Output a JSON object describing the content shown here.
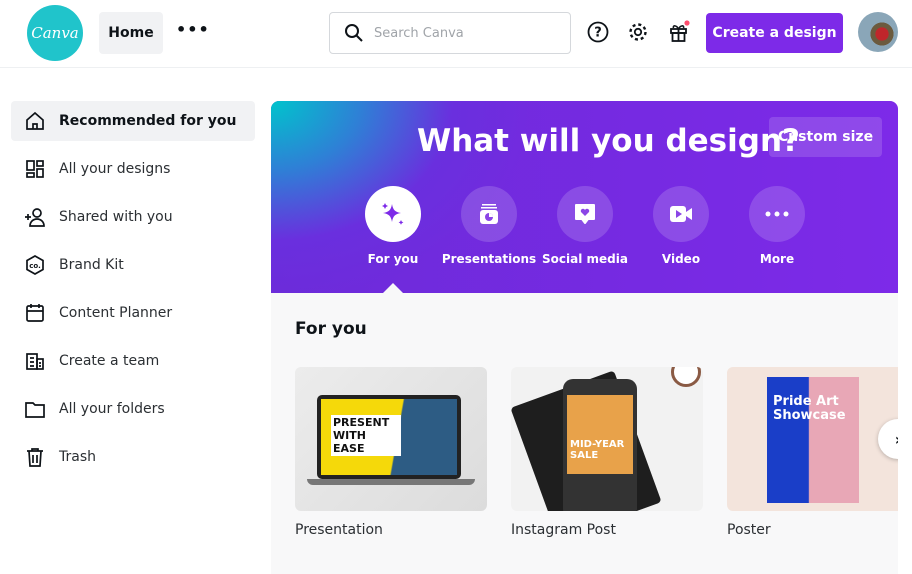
{
  "header": {
    "logo": "Canva",
    "home": "Home",
    "more": "•••",
    "search_placeholder": "Search Canva",
    "create": "Create a design",
    "notification_color": "#ff4d6d"
  },
  "sidebar": {
    "items": [
      {
        "label": "Recommended for you",
        "icon": "home-icon",
        "selected": true
      },
      {
        "label": "All your designs",
        "icon": "grid-icon"
      },
      {
        "label": "Shared with you",
        "icon": "users-icon"
      },
      {
        "label": "Brand Kit",
        "icon": "brand-kit-icon"
      },
      {
        "label": "Content Planner",
        "icon": "calendar-icon"
      },
      {
        "label": "Create a team",
        "icon": "building-icon"
      },
      {
        "label": "All your folders",
        "icon": "folder-icon"
      },
      {
        "label": "Trash",
        "icon": "trash-icon"
      }
    ]
  },
  "banner": {
    "title": "What will you design?",
    "custom_size": "Custom size",
    "categories": [
      {
        "label": "For you",
        "icon": "sparkle-icon"
      },
      {
        "label": "Presentations",
        "icon": "presentation-icon"
      },
      {
        "label": "Social media",
        "icon": "heart-bubble-icon"
      },
      {
        "label": "Video",
        "icon": "video-icon"
      },
      {
        "label": "More",
        "icon": "more-icon"
      }
    ]
  },
  "for_you": {
    "title": "For you",
    "cards": [
      {
        "label": "Presentation",
        "thumb_text": "PRESENT WITH EASE"
      },
      {
        "label": "Instagram Post",
        "thumb_text": "MID-YEAR SALE"
      },
      {
        "label": "Poster",
        "thumb_text": "Pride Art Showcase"
      }
    ]
  },
  "accent": "#7d2ae8"
}
